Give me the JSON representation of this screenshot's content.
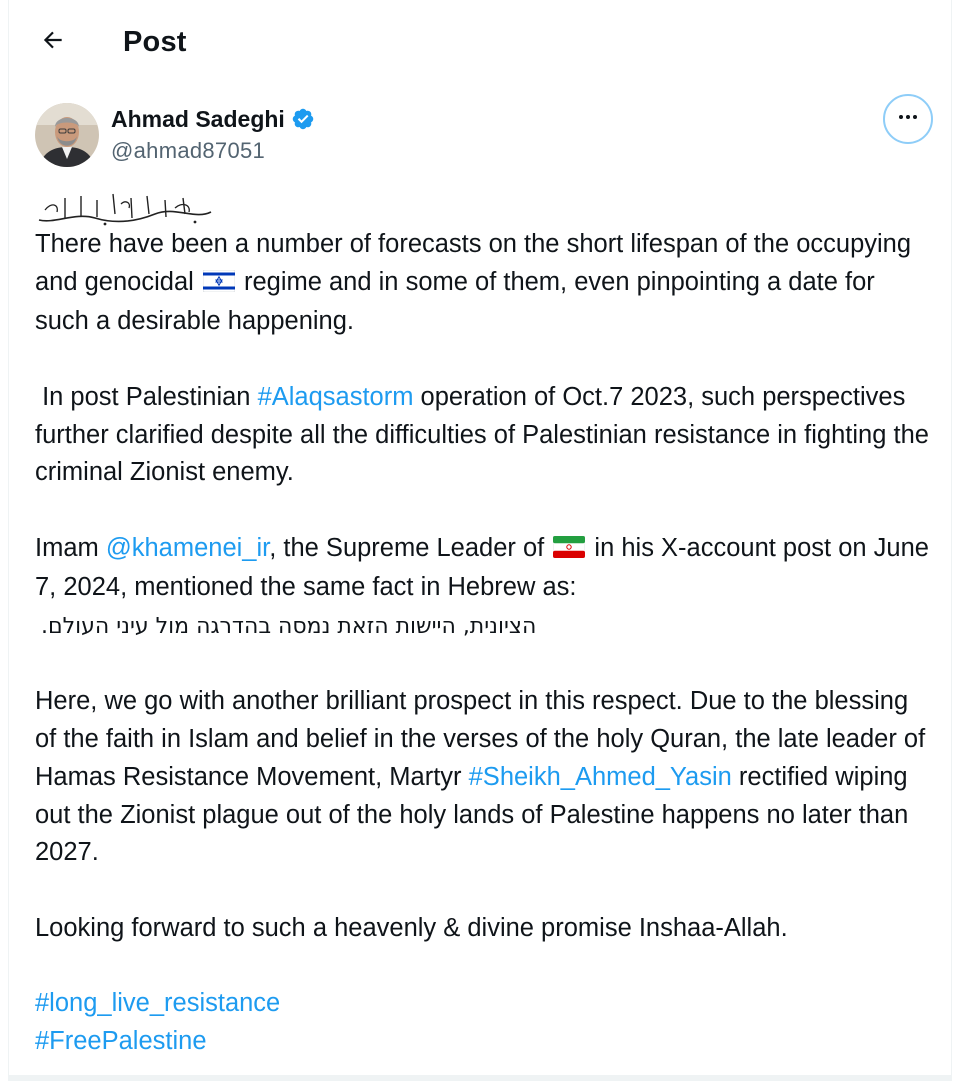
{
  "header": {
    "back_icon": "arrow-left-icon",
    "title": "Post"
  },
  "author": {
    "name": "Ahmad Sadeghi",
    "handle": "@ahmad87051",
    "verified_icon": "verified-badge-icon",
    "verified_color": "#1d9bf0"
  },
  "more_icon": "more-horizontal-icon",
  "calligraphy": "بِسْمِ اللَّهِ الرَّحْمَٰنِ الرَّحِيمِ",
  "post": {
    "p1": {
      "before_flag": "There have been a number of forecasts on the short lifespan of the occupying and genocidal ",
      "flag_icon": "israel-flag-icon",
      "after_flag": " regime and in some of them, even pinpointing a date for such a desirable happening."
    },
    "p2": {
      "before": " In post Palestinian ",
      "hashtag": "#Alaqsastorm",
      "after": " operation of Oct.7 2023, such perspectives further clarified despite all the difficulties of Palestinian resistance in fighting the criminal Zionist enemy."
    },
    "p3": {
      "before": "Imam ",
      "mention": "@khamenei_ir",
      "middle": ", the Supreme Leader of ",
      "flag_icon": "iran-flag-icon",
      "after": " in his X-account post on June 7, 2024, mentioned the same fact in Hebrew as:",
      "hebrew": "הציונית, היישות הזאת נמסה בהדרגה מול  עיני העולם."
    },
    "p4": {
      "before": "Here, we go with another brilliant prospect in this respect. Due to the blessing of the faith in Islam and belief in the verses of the holy Quran, the late leader of Hamas Resistance Movement, Martyr ",
      "hashtag": "#Sheikh_Ahmed_Yasin",
      "after": " rectified wiping out the Zionist plague out of the holy lands of Palestine happens no later than 2027."
    },
    "p5": "Looking forward to such a heavenly & divine promise Inshaa-Allah.",
    "hashtags": [
      "#long_live_resistance",
      "#FreePalestine"
    ]
  },
  "colors": {
    "link": "#1d9bf0",
    "text": "#0f1419",
    "secondary": "#536471"
  }
}
